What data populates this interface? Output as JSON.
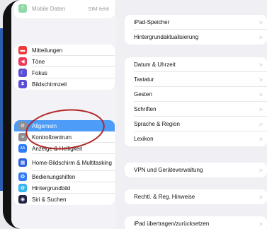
{
  "sidebar": {
    "top_group": [
      {
        "label": "Mobile Daten",
        "value": "SIM fehlt",
        "icon": "antenna-icon",
        "color": "#8fd9a8",
        "dim": true
      }
    ],
    "group2": [
      {
        "label": "Mitteilungen",
        "icon": "notifications-icon",
        "color": "#ef3b3b"
      },
      {
        "label": "Töne",
        "icon": "speaker-icon",
        "color": "#ef3b5a"
      },
      {
        "label": "Fokus",
        "icon": "moon-icon",
        "color": "#5b4fd6"
      },
      {
        "label": "Bildschirmzeit",
        "icon": "hourglass-icon",
        "color": "#5b4fd6"
      }
    ],
    "group3": [
      {
        "label": "Allgemein",
        "icon": "gear-icon",
        "color": "#8e8e93",
        "selected": true
      },
      {
        "label": "Kontrollzentrum",
        "icon": "switches-icon",
        "color": "#8e8e93"
      },
      {
        "label": "Anzeige & Helligkeit",
        "icon": "aa-icon",
        "color": "#2f7cf6"
      },
      {
        "label": "Home-Bildschirm & Multitasking",
        "icon": "grid-icon",
        "color": "#2f5fe0",
        "tall": true
      },
      {
        "label": "Bedienungshilfen",
        "icon": "accessibility-icon",
        "color": "#2f7cf6"
      },
      {
        "label": "Hintergrundbild",
        "icon": "flower-icon",
        "color": "#37b6ef"
      },
      {
        "label": "Siri & Suchen",
        "icon": "siri-icon",
        "color": "#222244"
      }
    ]
  },
  "detail": {
    "group1": [
      "iPad-Speicher",
      "Hintergrundaktualisierung"
    ],
    "group2": [
      "Datum & Uhrzeit",
      "Tastatur",
      "Gesten",
      "Schriften",
      "Sprache & Region",
      "Lexikon"
    ],
    "group3": [
      "VPN und Geräteverwaltung"
    ],
    "group4": [
      "Rechtl. & Reg. Hinweise"
    ],
    "group5": [
      "iPad übertragen/zurücksetzen"
    ]
  },
  "chevron": ">"
}
